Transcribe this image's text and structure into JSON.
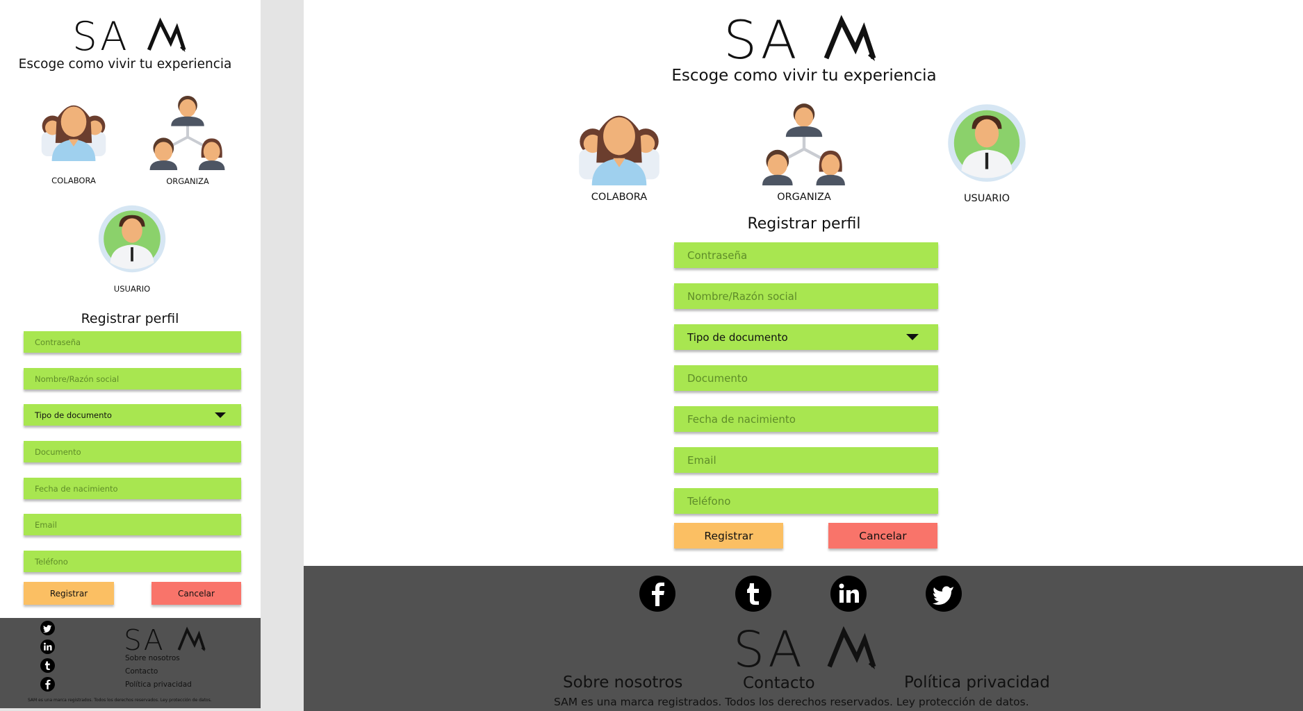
{
  "brand": {
    "logo_text": "SAM",
    "tagline": "Escoge como vivir tu experiencia"
  },
  "profiles": [
    {
      "label": "COLABORA",
      "icon": "group-icon"
    },
    {
      "label": "ORGANIZA",
      "icon": "hierarchy-icon"
    },
    {
      "label": "USUARIO",
      "icon": "user-icon"
    }
  ],
  "form": {
    "title": "Registrar perfil",
    "fields": [
      {
        "placeholder": "Contraseña"
      },
      {
        "placeholder": "Nombre/Razón social"
      },
      {
        "placeholder": "Tipo de documento",
        "type": "select"
      },
      {
        "placeholder": "Documento"
      },
      {
        "placeholder": "Fecha de nacimiento"
      },
      {
        "placeholder": "Email"
      },
      {
        "placeholder": "Teléfono"
      }
    ],
    "submit_label": "Registrar",
    "cancel_label": "Cancelar"
  },
  "footer": {
    "links": [
      "Sobre nosotros",
      "Contacto",
      "Política privacidad"
    ],
    "copyright": "SAM es una marca registrados. Todos los derechos reservados. Ley protección de datos.",
    "social": [
      "facebook-icon",
      "tumblr-icon",
      "linkedin-icon",
      "twitter-icon"
    ]
  },
  "colors": {
    "field": "#a8e650",
    "submit": "#fbbf63",
    "cancel": "#f9746a",
    "footer": "#515151",
    "backdrop": "#e4e4e4"
  }
}
